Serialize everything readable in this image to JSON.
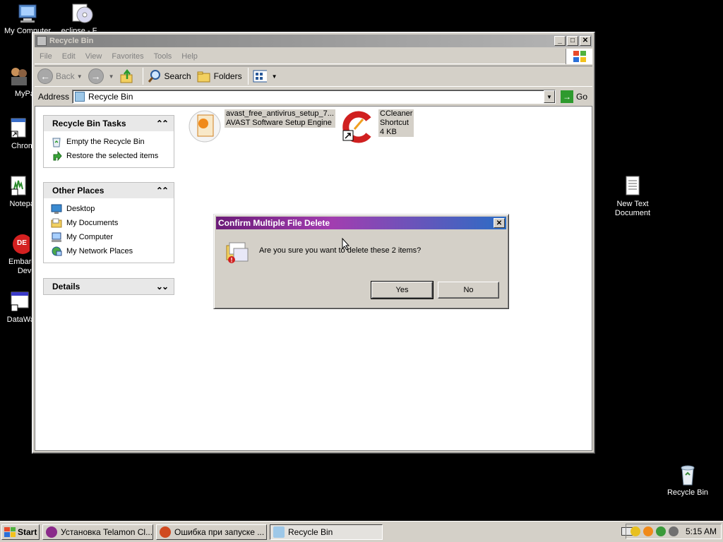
{
  "desktop": {
    "icons": [
      {
        "label": "My Computer",
        "name": "my-computer"
      },
      {
        "label": "eclipse - F...",
        "name": "eclipse"
      },
      {
        "label": "MyPa",
        "name": "mypa"
      },
      {
        "label": "Chrom",
        "name": "chrome"
      },
      {
        "label": "Notepa",
        "name": "notepad"
      },
      {
        "label": "Embarca",
        "label2": "Dev-C",
        "name": "embarcadero"
      },
      {
        "label": "DataWa",
        "name": "datawa"
      },
      {
        "label": "New Text",
        "label2": "Document",
        "name": "new-text-document"
      },
      {
        "label": "Recycle Bin",
        "name": "recycle-bin"
      }
    ]
  },
  "window": {
    "title": "Recycle Bin",
    "menu": [
      "File",
      "Edit",
      "View",
      "Favorites",
      "Tools",
      "Help"
    ],
    "toolbar": {
      "back": "Back",
      "search": "Search",
      "folders": "Folders"
    },
    "address": {
      "label": "Address",
      "value": "Recycle Bin",
      "go": "Go"
    },
    "tasks_panel": {
      "title": "Recycle Bin Tasks",
      "items": [
        "Empty the Recycle Bin",
        "Restore the selected items"
      ]
    },
    "places_panel": {
      "title": "Other Places",
      "items": [
        "Desktop",
        "My Documents",
        "My Computer",
        "My Network Places"
      ]
    },
    "details_panel": {
      "title": "Details"
    },
    "files": [
      {
        "line1": "avast_free_antivirus_setup_7...",
        "line2": "AVAST Software Setup Engine"
      },
      {
        "line1": "CCleaner",
        "line2": "Shortcut",
        "line3": "4 KB"
      }
    ]
  },
  "dialog": {
    "title": "Confirm Multiple File Delete",
    "message": "Are you sure you want to delete these 2 items?",
    "yes": "Yes",
    "no": "No"
  },
  "taskbar": {
    "start": "Start",
    "tasks": [
      "Установка Telamon Cl...",
      "Ошибка при запуске ...",
      "Recycle Bin"
    ],
    "clock": "5:15 AM"
  }
}
